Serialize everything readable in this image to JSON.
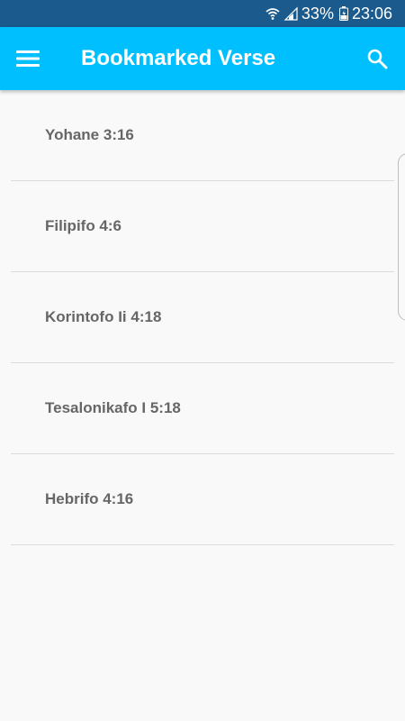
{
  "status_bar": {
    "battery": "33%",
    "time": "23:06",
    "icons": [
      "wifi-icon",
      "signal-icon",
      "battery-icon"
    ]
  },
  "app_bar": {
    "title": "Bookmarked Verse",
    "menu_icon": "hamburger-menu-icon",
    "search_icon": "search-icon"
  },
  "bookmarks": [
    {
      "label": "Yohane 3:16"
    },
    {
      "label": "Filipifo 4:6"
    },
    {
      "label": "Korintofo Ii 4:18"
    },
    {
      "label": "Tesalonikafo I 5:18"
    },
    {
      "label": "Hebrifo 4:16"
    }
  ],
  "colors": {
    "status_bar": "#1a5a8c",
    "app_bar": "#00bfff",
    "background": "#f9f9f9",
    "item_text": "#666666",
    "divider": "#dcdcdc"
  }
}
